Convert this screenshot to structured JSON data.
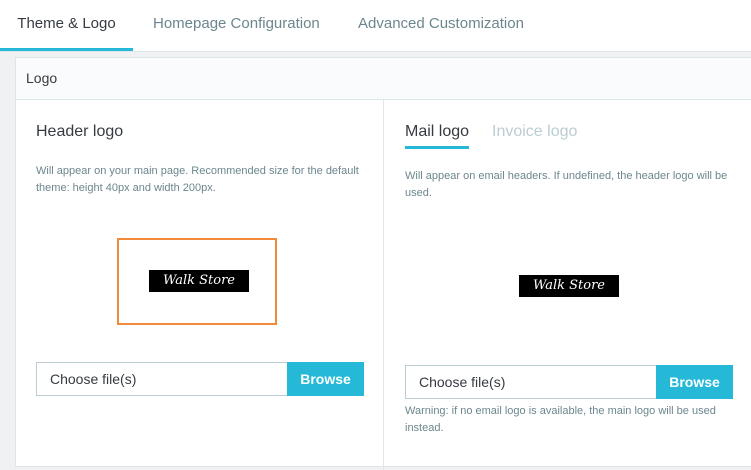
{
  "tabs": [
    {
      "label": "Theme & Logo",
      "active": true
    },
    {
      "label": "Homepage Configuration",
      "active": false
    },
    {
      "label": "Advanced Customization",
      "active": false
    }
  ],
  "card": {
    "title": "Logo"
  },
  "header_logo": {
    "title": "Header logo",
    "help": "Will appear on your main page. Recommended size for the default theme: height 40px and width 200px.",
    "logo_text": "Walk Store",
    "file_placeholder": "Choose file(s)",
    "browse_label": "Browse"
  },
  "mail_section": {
    "subtabs": [
      {
        "label": "Mail logo",
        "active": true
      },
      {
        "label": "Invoice logo",
        "active": false
      }
    ],
    "help": "Will appear on email headers. If undefined, the header logo will be used.",
    "logo_text": "Walk Store",
    "file_placeholder": "Choose file(s)",
    "browse_label": "Browse",
    "warning": "Warning: if no email logo is available, the main logo will be used instead."
  },
  "colors": {
    "accent": "#25b9d7",
    "highlight": "#f28a3c",
    "text": "#363a41",
    "muted": "#6c868e"
  }
}
